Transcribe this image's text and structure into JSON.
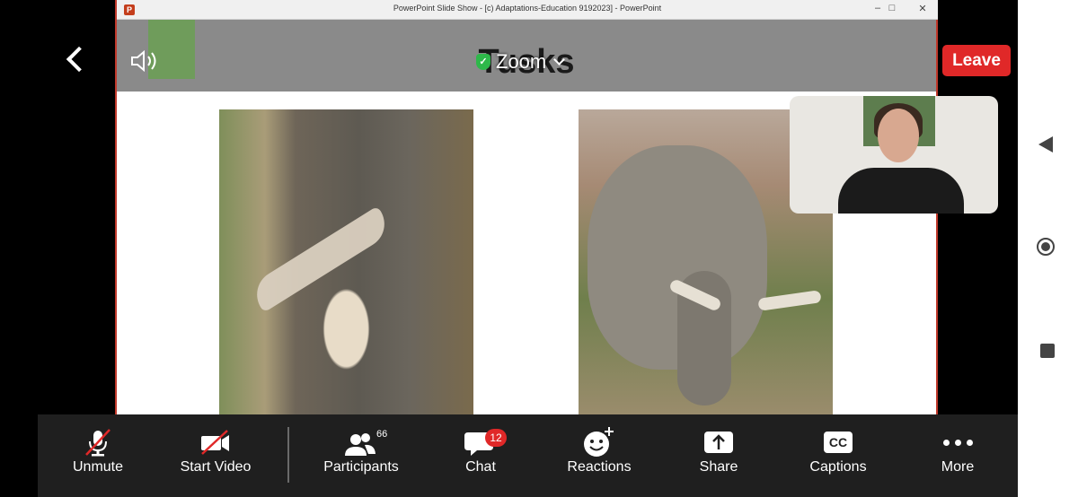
{
  "window": {
    "title": "PowerPoint Slide Show - [c) Adaptations-Education 9192023] - PowerPoint",
    "minimize_icon": "–",
    "maximize_icon": "□",
    "close_icon": "✕"
  },
  "slide": {
    "title": "Tusks"
  },
  "meeting": {
    "app_label": "Zoom",
    "leave_label": "Leave"
  },
  "toolbar": {
    "unmute": "Unmute",
    "start_video": "Start Video",
    "participants": "Participants",
    "participants_count": "66",
    "chat": "Chat",
    "chat_count": "12",
    "reactions": "Reactions",
    "share": "Share",
    "captions": "Captions",
    "captions_icon_text": "CC",
    "more": "More"
  },
  "colors": {
    "leave": "#e02828",
    "toolbar_bg": "#1f1f1f",
    "encrypted_shield": "#2eb84a"
  }
}
